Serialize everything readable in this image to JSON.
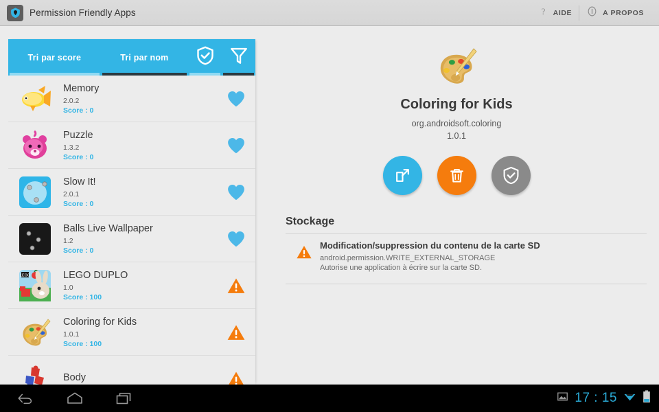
{
  "window": {
    "title": "Permission Friendly Apps",
    "logo_icon": "shield-icon"
  },
  "header_actions": [
    {
      "icon": "question-mark-icon",
      "label": "AIDE"
    },
    {
      "icon": "info-circle-icon",
      "label": "A PROPOS"
    }
  ],
  "tabs": [
    {
      "id": "sort-by-score",
      "label": "Tri par score",
      "active": true,
      "type": "text"
    },
    {
      "id": "sort-by-name",
      "label": "Tri par nom",
      "active": false,
      "type": "text"
    },
    {
      "id": "shield-filter",
      "icon": "shield-check-icon",
      "active": true,
      "type": "icon"
    },
    {
      "id": "funnel-filter",
      "icon": "funnel-filter-icon",
      "active": false,
      "type": "icon"
    }
  ],
  "apps": [
    {
      "name": "Memory",
      "version": "2.0.2",
      "score_label": "Score : 0",
      "status": "favorite",
      "icon": "fish-icon"
    },
    {
      "name": "Puzzle",
      "version": "1.3.2",
      "score_label": "Score : 0",
      "status": "favorite",
      "icon": "bear-icon"
    },
    {
      "name": "Slow It!",
      "version": "2.0.1",
      "score_label": "Score : 0",
      "status": "favorite",
      "icon": "balls-blue-icon"
    },
    {
      "name": "Balls Live Wallpaper",
      "version": "1.2",
      "score_label": "Score : 0",
      "status": "favorite",
      "icon": "balls-dark-icon"
    },
    {
      "name": "LEGO DUPLO",
      "version": "1.0",
      "score_label": "Score : 100",
      "status": "warning",
      "icon": "rabbit-icon"
    },
    {
      "name": "Coloring for Kids",
      "version": "1.0.1",
      "score_label": "Score : 100",
      "status": "warning",
      "icon": "palette-icon"
    },
    {
      "name": "Body",
      "version": "",
      "score_label": "",
      "status": "warning",
      "icon": "puzzle-pieces-icon"
    }
  ],
  "detail": {
    "icon": "palette-icon",
    "name": "Coloring for Kids",
    "package": "org.androidsoft.coloring",
    "version": "1.0.1",
    "actions": [
      {
        "id": "launch",
        "icon": "open-external-icon",
        "color": "#33b5e5"
      },
      {
        "id": "uninstall",
        "icon": "trash-icon",
        "color": "#f57c0d"
      },
      {
        "id": "shield",
        "icon": "shield-check-icon",
        "color": "#8a8a8a"
      }
    ],
    "section_title": "Stockage",
    "permissions": [
      {
        "icon": "warning-triangle-icon",
        "title": "Modification/suppression du contenu de la carte SD",
        "constant": "android.permission.WRITE_EXTERNAL_STORAGE",
        "description": "Autorise une application à écrire sur la carte SD."
      }
    ]
  },
  "system_bar": {
    "nav": [
      {
        "id": "back",
        "icon": "back-arrow-icon"
      },
      {
        "id": "home",
        "icon": "home-icon"
      },
      {
        "id": "recents",
        "icon": "recents-icon"
      }
    ],
    "screenshot_icon": "image-icon",
    "clock": "17 : 15",
    "wifi_icon": "wifi-icon",
    "battery_icon": "battery-icon"
  },
  "colors": {
    "accent_blue": "#33b5e5",
    "warning_orange": "#f57c0d",
    "clock_blue": "#2aa9d4"
  }
}
